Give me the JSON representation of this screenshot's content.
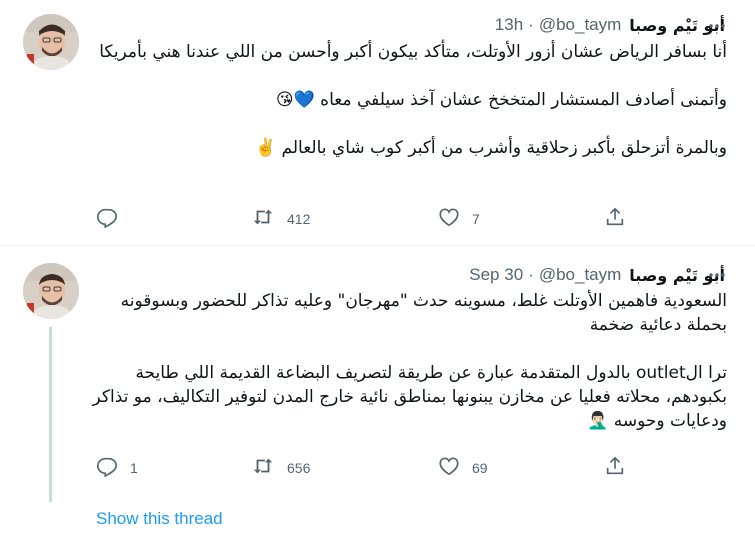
{
  "tweets": [
    {
      "author_name": "أبو تَيْم وصبا",
      "handle": "@bo_taym",
      "separator": "·",
      "time": "13h",
      "lines": [
        "أنا بسافر الرياض عشان أزور الأوتلت، متأكد بيكون أكبر وأحسن من اللي عندنا هني بأمريكا",
        "",
        "وأتمنى أصادف المستشار المتخخخ عشان آخذ سيلفي معاه 💙😘",
        "",
        "وبالمرة أتزحلق بأكبر زحلاقية وأشرب من أكبر كوب شاي بالعالم ✌️"
      ],
      "reply_count": "",
      "retweet_count": "412",
      "like_count": "7"
    },
    {
      "author_name": "أبو تَيْم وصبا",
      "handle": "@bo_taym",
      "separator": "·",
      "time": "Sep 30",
      "lines": [
        "السعودية فاهمين الأوتلت غلط، مسوينه حدث \"مهرجان\" وعليه تذاكر للحضور وبسوقونه بحملة دعائية ضخمة",
        "",
        "ترا الoutlet بالدول المتقدمة عبارة عن طريقة لتصريف البضاعة القديمة اللي طايحة بكبودهم، محلاته فعليا عن مخازن يبنونها بمناطق نائية خارج المدن لتوفير التكاليف، مو تذاكر ودعايات وحوسه 🤦🏻‍♂️"
      ],
      "reply_count": "1",
      "retweet_count": "656",
      "like_count": "69",
      "show_thread": "Show this thread"
    }
  ],
  "icons": {
    "more": "more-icon",
    "reply": "reply-icon",
    "retweet": "retweet-icon",
    "like": "like-icon",
    "share": "share-icon"
  },
  "colors": {
    "text": "#0f1419",
    "secondary": "#536471",
    "link": "#1d9bf0",
    "divider": "#eff3f4"
  }
}
